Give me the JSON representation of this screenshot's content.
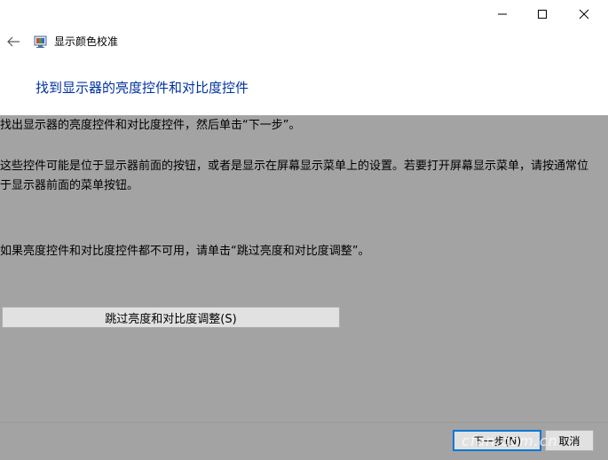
{
  "window": {
    "app_title": "显示颜色校准",
    "controls": {
      "minimize": "minimize-icon",
      "maximize": "maximize-icon",
      "close": "close-icon"
    }
  },
  "header": {
    "back_icon": "back-arrow-icon",
    "app_icon": "display-color-calibration-icon",
    "page_title": "找到显示器的亮度控件和对比度控件",
    "title_color": "#0033a0"
  },
  "body": {
    "instruction": "找出显示器的亮度控件和对比度控件，然后单击“下一步”。",
    "explanation": "这些控件可能是位于显示器前面的按钮，或者是显示在屏幕显示菜单上的设置。若要打开屏幕显示菜单，请按通常位于显示器前面的菜单按钮。",
    "skip_hint": "如果亮度控件和对比度控件都不可用，请单击“跳过亮度和对比度调整”。",
    "skip_button": "跳过亮度和对比度调整(S)"
  },
  "footer": {
    "next_button": "下一步(N)",
    "cancel_button": "取消"
  },
  "colors": {
    "background": "#a3a3a3",
    "accent": "#0078d7"
  },
  "watermark": "cfan.com.cn"
}
